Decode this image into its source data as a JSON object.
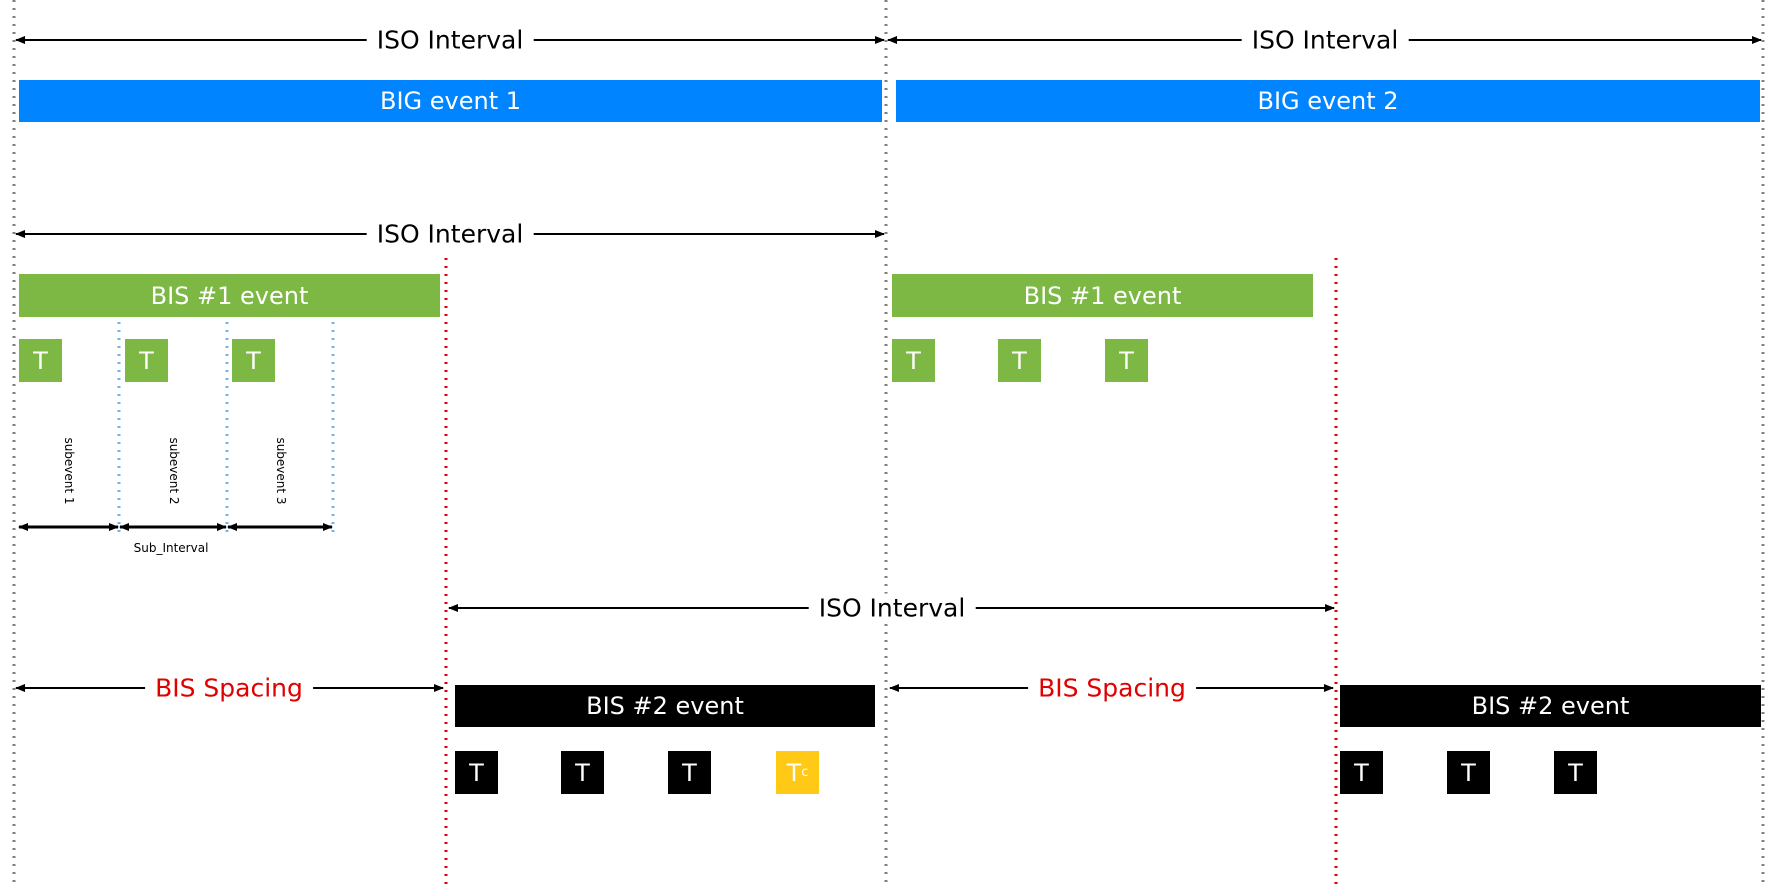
{
  "colors": {
    "big": "#0084ff",
    "bis1": "#7cb843",
    "bis2": "#000000",
    "control": "#ffc915",
    "spacing_text": "#e00000",
    "iso_boundary": "#808080",
    "bis_boundary": "#e00000",
    "subevent_boundary": "#6fb4f0"
  },
  "iso_interval_label": "ISO Interval",
  "big_events": [
    "BIG event 1",
    "BIG event 2"
  ],
  "bis1_event": "BIS #1 event",
  "bis2_event": "BIS #2 event",
  "packet_label": "T",
  "control_packet": {
    "main": "T",
    "sub": "c"
  },
  "subevents": [
    "subevent 1",
    "subevent 2",
    "subevent 3"
  ],
  "sub_interval_label": "Sub_Interval",
  "bis_spacing_label": "BIS Spacing"
}
